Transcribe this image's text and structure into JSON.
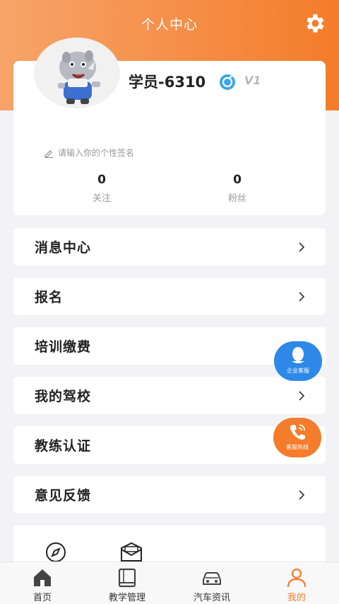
{
  "header": {
    "title": "个人中心"
  },
  "profile": {
    "username": "学员-6310",
    "level": "V1",
    "signature_placeholder": "请输入你的个性签名",
    "stats": [
      {
        "value": "0",
        "label": "关注"
      },
      {
        "value": "0",
        "label": "粉丝"
      }
    ]
  },
  "menu": [
    {
      "label": "消息中心"
    },
    {
      "label": "报名"
    },
    {
      "label": "培训缴费"
    },
    {
      "label": "我的驾校"
    },
    {
      "label": "教练认证"
    },
    {
      "label": "意见反馈"
    }
  ],
  "floating": {
    "qq_label": "企业客服",
    "phone_label": "客服热线"
  },
  "tabbar": [
    {
      "label": "首页",
      "icon": "home-icon"
    },
    {
      "label": "教学管理",
      "icon": "book-icon"
    },
    {
      "label": "汽车资讯",
      "icon": "car-icon"
    },
    {
      "label": "我的",
      "icon": "user-icon"
    }
  ],
  "colors": {
    "accent": "#f47c2a",
    "qq_blue": "#2e88e8",
    "background": "#f3f3f6"
  }
}
